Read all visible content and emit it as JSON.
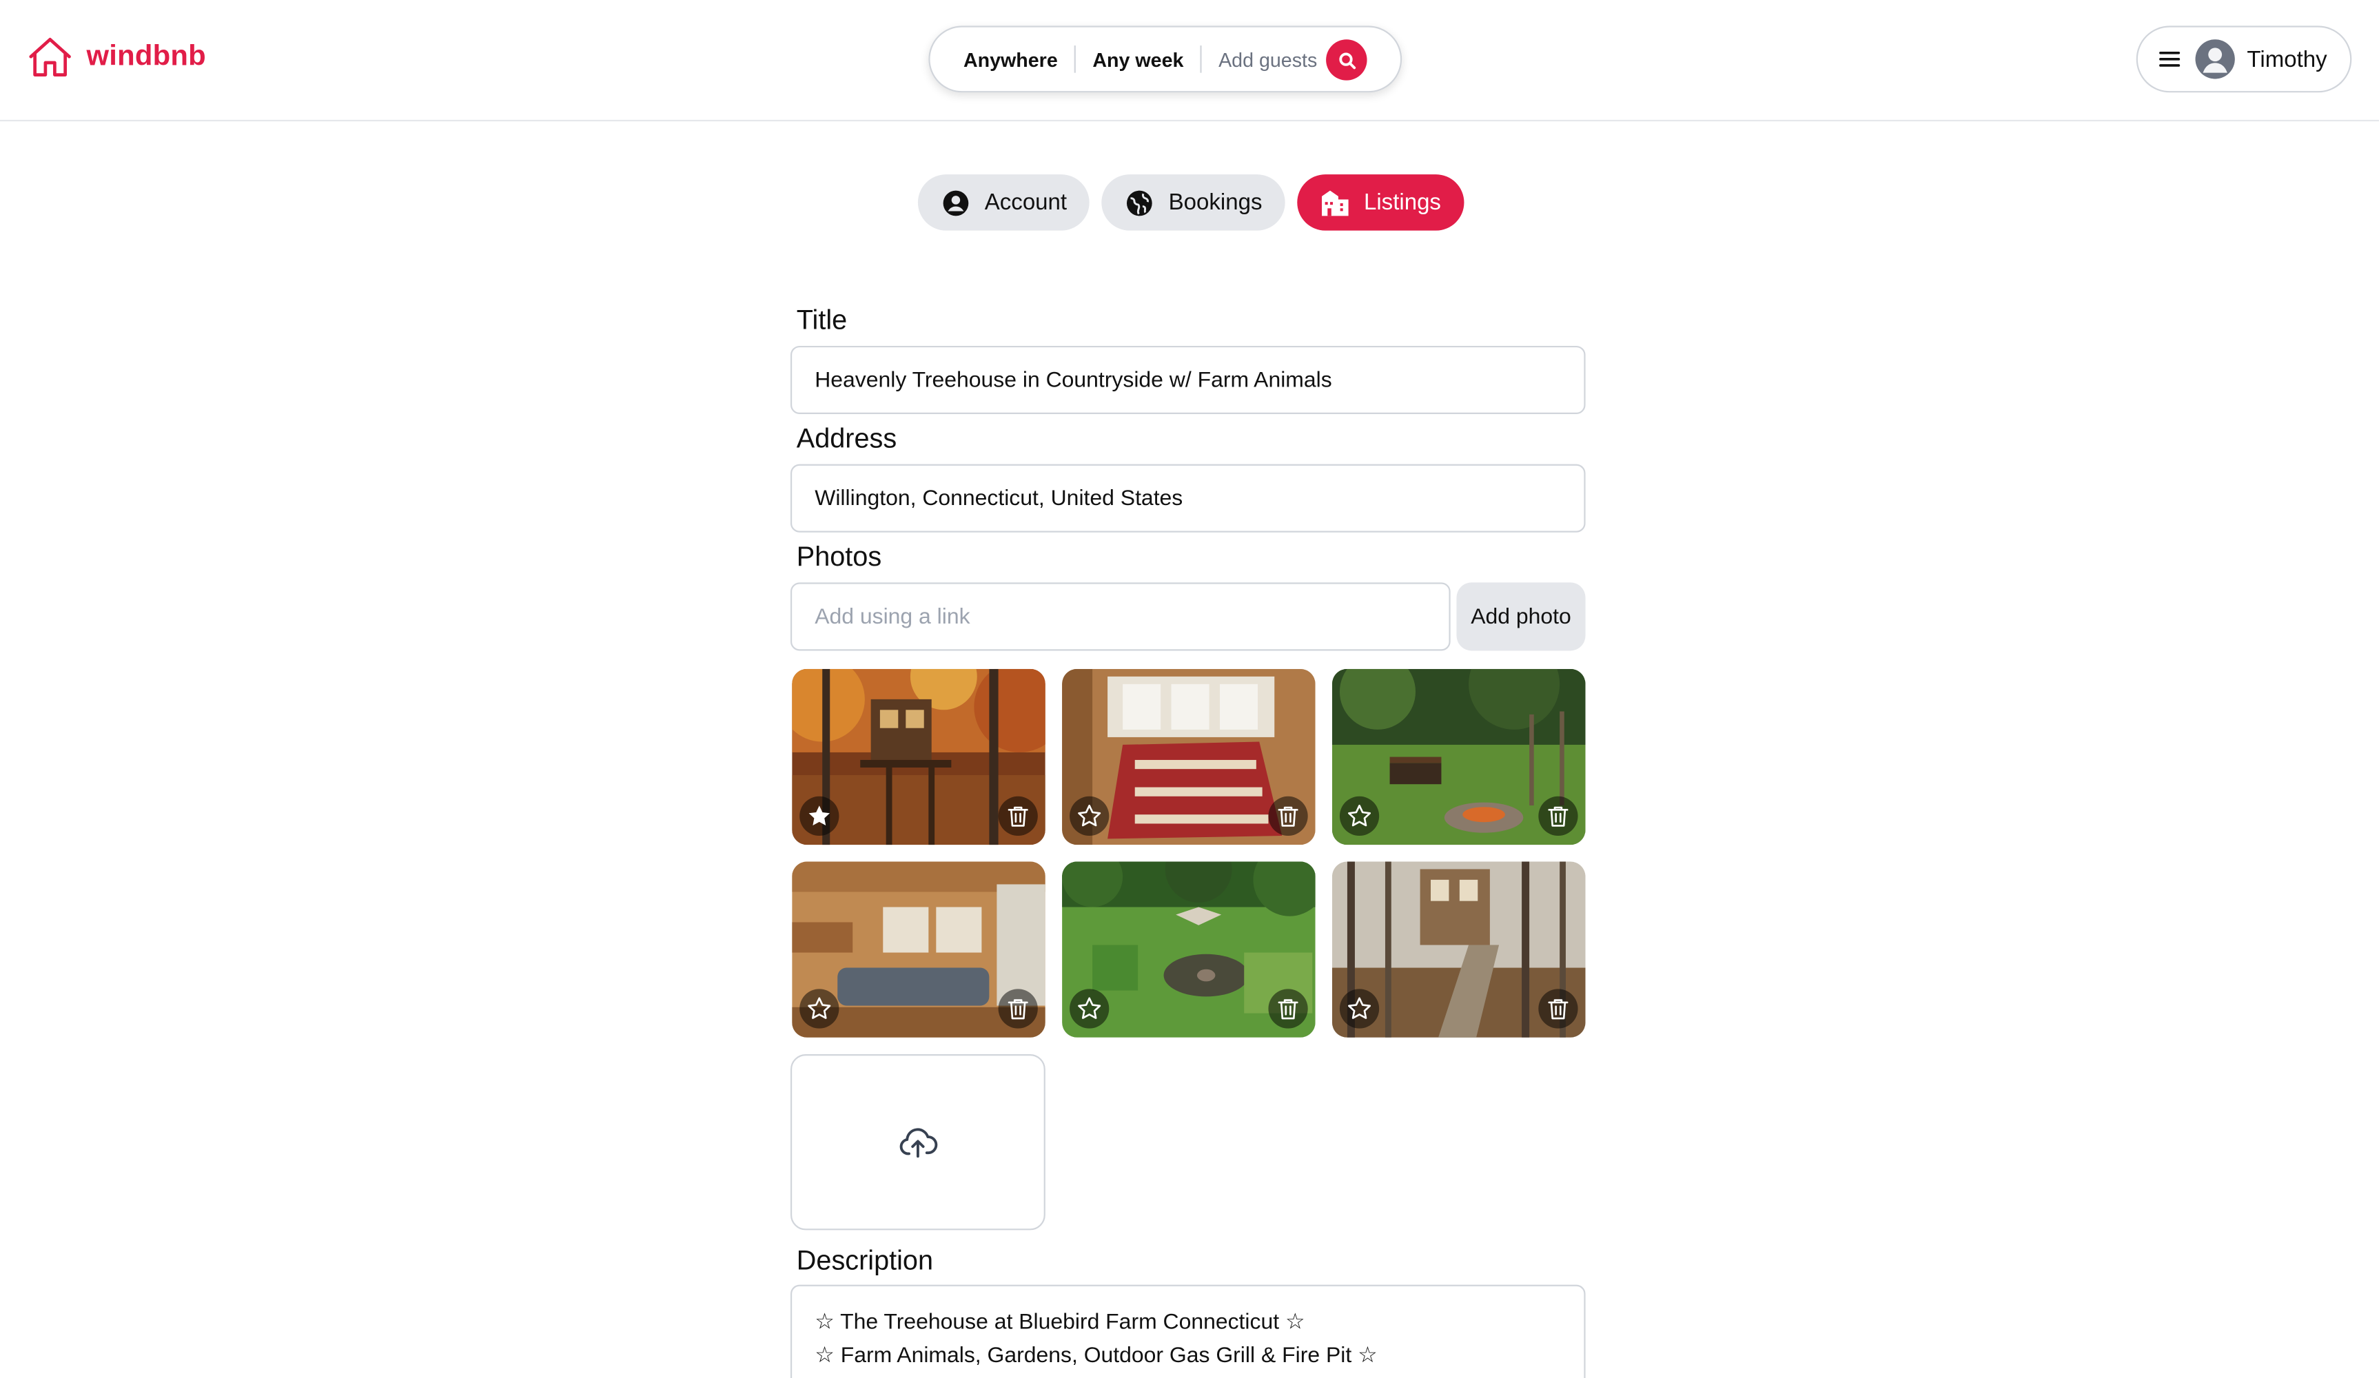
{
  "app": {
    "name": "windbnb",
    "brand_color": "#e11d48"
  },
  "header": {
    "search": {
      "location": "Anywhere",
      "week": "Any week",
      "guests": "Add guests"
    },
    "user": {
      "name": "Timothy"
    }
  },
  "tabs": [
    {
      "label": "Account",
      "icon": "user-circle-icon",
      "active": false
    },
    {
      "label": "Bookings",
      "icon": "globe-icon",
      "active": false
    },
    {
      "label": "Listings",
      "icon": "building-icon",
      "active": true
    }
  ],
  "form": {
    "title_label": "Title",
    "title_value": "Heavenly Treehouse in Countryside w/ Farm Animals",
    "address_label": "Address",
    "address_value": "Willington, Connecticut, United States",
    "photos_label": "Photos",
    "photo_link_placeholder": "Add using a link",
    "add_photo_label": "Add photo",
    "photos": [
      {
        "subject": "treehouse exterior in autumn",
        "main": true
      },
      {
        "subject": "bedroom with red quilt",
        "main": false
      },
      {
        "subject": "lawn with bench and fire pit",
        "main": false
      },
      {
        "subject": "wooden interior living area",
        "main": false
      },
      {
        "subject": "aerial view of garden and fire circle",
        "main": false
      },
      {
        "subject": "treehouse with stairs among trees",
        "main": false
      }
    ],
    "description_label": "Description",
    "description_lines": [
      "☆ The Treehouse at Bluebird Farm Connecticut ☆",
      "☆ Farm Animals, Gardens, Outdoor Gas Grill & Fire Pit ☆"
    ]
  }
}
